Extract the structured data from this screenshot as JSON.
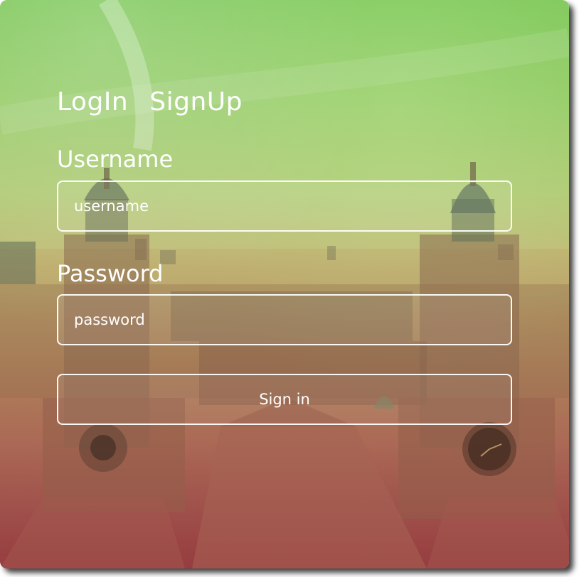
{
  "tabs": {
    "login": "LogIn",
    "signup": "SignUp"
  },
  "username": {
    "label": "Username",
    "placeholder": "username"
  },
  "password": {
    "label": "Password",
    "placeholder": "password"
  },
  "submit": {
    "label": "Sign in"
  },
  "colors": {
    "sky_top": "#7fc85a",
    "city_bottom": "#983c40",
    "text": "#ffffff"
  }
}
